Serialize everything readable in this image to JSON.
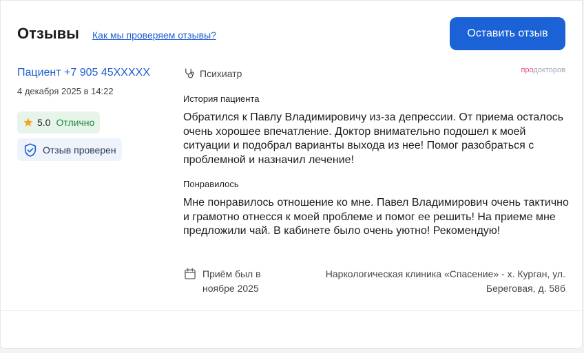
{
  "header": {
    "title": "Отзывы",
    "check_link": "Как мы проверяем отзывы?",
    "leave_review": "Оставить отзыв"
  },
  "review": {
    "author": "Пациент +7 905 45XXXXX",
    "date": "4 декабря 2025 в 14:22",
    "rating": {
      "score": "5.0",
      "label": "Отлично"
    },
    "verified": "Отзыв проверен",
    "specialty": "Психиатр",
    "brand": {
      "pro": "про",
      "rest": "докторов"
    },
    "history_title": "История пациента",
    "history_text": "Обратился к Павлу Владимировичу из-за депрессии. От приема осталось очень хорошее впечатление. Доктор внимательно подошел к моей ситуации и подобрал варианты выхода из нее! Помог разобраться с проблемной и назначил лечение!",
    "liked_title": "Понравилось",
    "liked_text": "Мне понравилось отношение ко мне. Павел Владимирович очень тактично и грамотно отнесся к моей проблеме и помог ее решить! На приеме мне предложили чай. В кабинете было очень уютно! Рекомендую!",
    "visit": "Приём был в ноябре  2025",
    "clinic": "Наркологическая клиника «Спасение» - х. Курган, ул. Береговая, д. 58б"
  },
  "colors": {
    "accent": "#1a62d6",
    "link": "#1e5fcf",
    "rating_bg": "#e6f4ea",
    "rating_text": "#1f8a3c",
    "star": "#f4a522",
    "verified_bg": "#eef3fc"
  },
  "icons": {
    "star": "star-icon",
    "shield": "shield-check-icon",
    "specialty": "stethoscope-icon",
    "calendar": "calendar-icon"
  }
}
